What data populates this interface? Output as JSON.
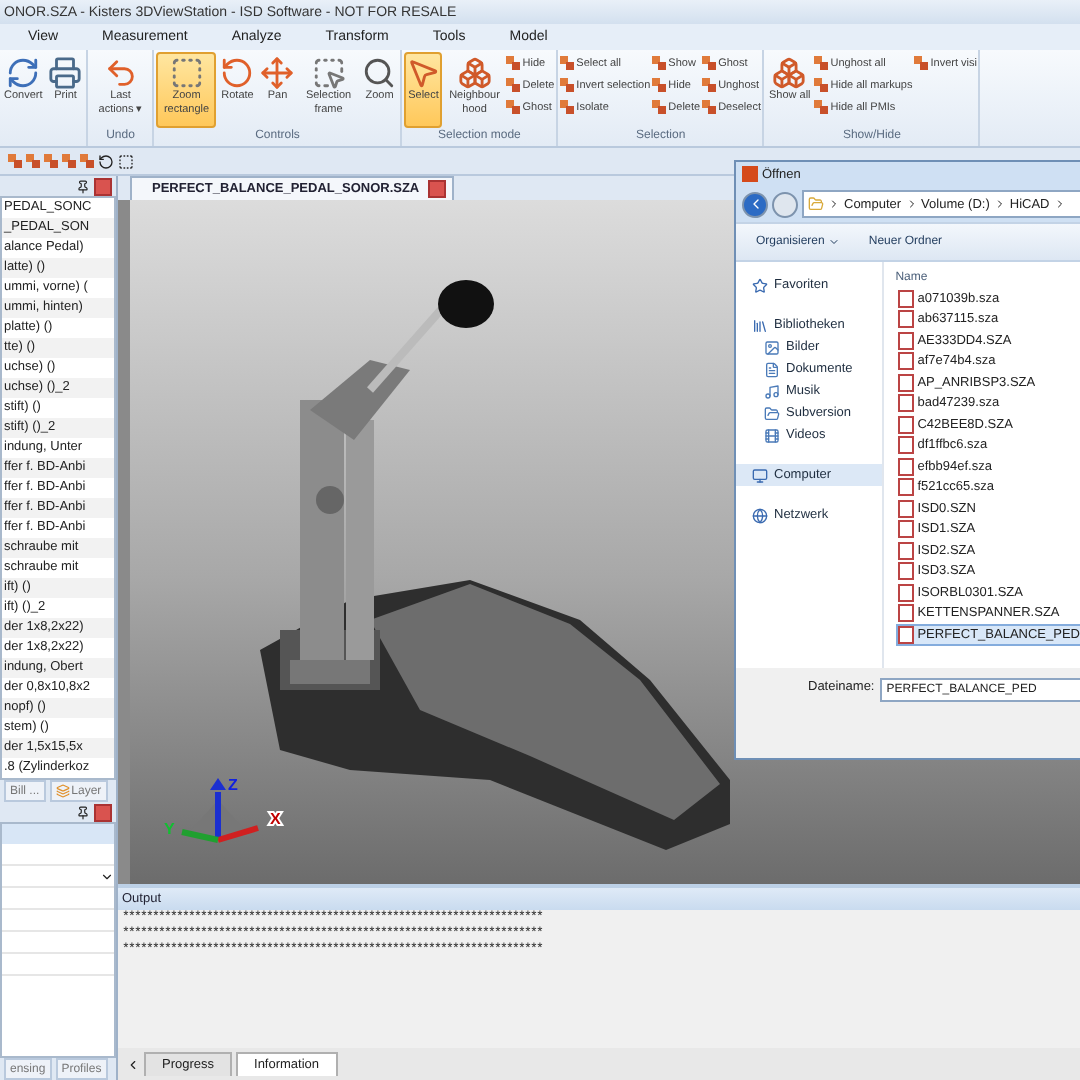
{
  "window": {
    "title": "ONOR.SZA - Kisters 3DViewStation - ISD Software - NOT FOR RESALE"
  },
  "menu": [
    "View",
    "Measurement",
    "Analyze",
    "Transform",
    "Tools",
    "Model"
  ],
  "ribbon": {
    "groups": [
      {
        "large": [
          {
            "label": "Convert",
            "selected": false
          },
          {
            "label": "Print",
            "selected": false
          }
        ]
      },
      {
        "label": "Undo",
        "large": [
          {
            "label": "Last actions ▾",
            "selected": false
          }
        ]
      },
      {
        "label": "Controls",
        "large": [
          {
            "label": "Zoom rectangle",
            "selected": true
          },
          {
            "label": "Rotate",
            "selected": false
          },
          {
            "label": "Pan",
            "selected": false
          },
          {
            "label": "Selection frame",
            "selected": false
          },
          {
            "label": "Zoom",
            "selected": false
          }
        ]
      },
      {
        "label": "Selection mode",
        "large": [
          {
            "label": "Select",
            "selected": true
          },
          {
            "label": "Neighbour hood",
            "selected": false
          }
        ],
        "small": [
          "Hide",
          "Delete",
          "Ghost"
        ]
      },
      {
        "label": "Selection",
        "small": [
          "Select all",
          "Invert selection",
          "Isolate",
          "Show",
          "Hide",
          "Delete",
          "Ghost",
          "Unghost",
          "Deselect"
        ]
      },
      {
        "label": "Show/Hide",
        "large": [
          {
            "label": "Show all",
            "selected": false
          }
        ],
        "small": [
          "Unghost all",
          "Hide all markups",
          "Hide all PMIs",
          "Invert visi"
        ]
      }
    ]
  },
  "tree": [
    "PEDAL_SONC",
    "_PEDAL_SON",
    "alance Pedal)",
    "latte) ()",
    "ummi, vorne) (",
    "ummi, hinten)",
    "platte) ()",
    "tte) ()",
    "uchse) ()",
    "uchse) ()_2",
    "stift) ()",
    "stift) ()_2",
    "indung, Unter",
    "ffer f. BD-Anbi",
    "ffer f. BD-Anbi",
    "ffer f. BD-Anbi",
    "ffer f. BD-Anbi",
    "schraube mit",
    "schraube mit",
    "ift) ()",
    "ift) ()_2",
    "der 1x8,2x22)",
    "der 1x8,2x22)",
    "indung, Obert",
    "der 0,8x10,8x2",
    "nopf) ()",
    "stem) ()",
    "der 1,5x15,5x",
    ".8 (Zylinderkoz"
  ],
  "panel_tabs": [
    "Bill ...",
    "Layer"
  ],
  "left_bottom_tabs": [
    "ensing",
    "Profiles"
  ],
  "document_tab": "PERFECT_BALANCE_PEDAL_SONOR.SZA",
  "axis_labels": [
    "Z",
    "Y",
    "X"
  ],
  "dialog": {
    "title": "Öffnen",
    "path": [
      "Computer",
      "Volume (D:)",
      "HiCAD"
    ],
    "toolbar": [
      "Organisieren",
      "Neuer Ordner"
    ],
    "nav": [
      {
        "label": "Favoriten",
        "selected": false
      },
      {
        "label": "Bibliotheken",
        "selected": false,
        "children": [
          {
            "label": "Bilder",
            "selected": false
          },
          {
            "label": "Dokumente",
            "selected": false
          },
          {
            "label": "Musik",
            "selected": false
          },
          {
            "label": "Subversion",
            "selected": false
          },
          {
            "label": "Videos",
            "selected": false
          }
        ]
      },
      {
        "label": "Computer",
        "selected": true
      },
      {
        "label": "Netzwerk",
        "selected": false
      }
    ],
    "column_header": "Name",
    "files": [
      {
        "name": "a071039b.sza",
        "selected": false
      },
      {
        "name": "ab637115.sza",
        "selected": false
      },
      {
        "name": "AE333DD4.SZA",
        "selected": false
      },
      {
        "name": "af7e74b4.sza",
        "selected": false
      },
      {
        "name": "AP_ANRIBSP3.SZA",
        "selected": false
      },
      {
        "name": "bad47239.sza",
        "selected": false
      },
      {
        "name": "C42BEE8D.SZA",
        "selected": false
      },
      {
        "name": "df1ffbc6.sza",
        "selected": false
      },
      {
        "name": "efbb94ef.sza",
        "selected": false
      },
      {
        "name": "f521cc65.sza",
        "selected": false
      },
      {
        "name": "ISD0.SZN",
        "selected": false
      },
      {
        "name": "ISD1.SZA",
        "selected": false
      },
      {
        "name": "ISD2.SZA",
        "selected": false
      },
      {
        "name": "ISD3.SZA",
        "selected": false
      },
      {
        "name": "ISORBL0301.SZA",
        "selected": false
      },
      {
        "name": "KETTENSPANNER.SZA",
        "selected": false
      },
      {
        "name": "PERFECT_BALANCE_PED",
        "selected": true
      }
    ],
    "filename_label": "Dateiname:",
    "filename": "PERFECT_BALANCE_PED"
  },
  "output": {
    "title": "Output",
    "lines": [
      "**********************************************************************",
      "**********************************************************************",
      "**********************************************************************"
    ]
  },
  "bottom_tabs": [
    {
      "label": "Progress",
      "selected": false
    },
    {
      "label": "Information",
      "selected": true
    }
  ]
}
